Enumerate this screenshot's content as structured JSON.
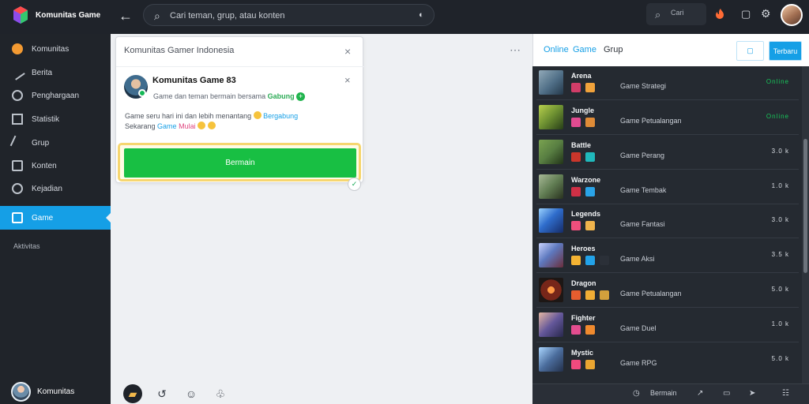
{
  "app": {
    "name": "Komunitas Game",
    "colors": {
      "accent": "#159fe6",
      "success": "#18bf43",
      "dark": "#1f232a"
    }
  },
  "topbar": {
    "back_icon": "arrow-left-icon",
    "search_placeholder": "Cari teman, grup, atau konten",
    "notification_label": "Cari",
    "icons": [
      "search-icon",
      "fire-icon",
      "copy-icon",
      "gear-icon",
      "avatar"
    ]
  },
  "sidebar": {
    "items": [
      {
        "label": "Komunitas",
        "icon": "coin-icon"
      },
      {
        "label": "Berita",
        "icon": "pen-icon"
      },
      {
        "label": "Penghargaan",
        "icon": "globe-icon"
      },
      {
        "label": "Statistik",
        "icon": "chart-icon"
      },
      {
        "label": "Grup",
        "icon": "microphone-icon"
      },
      {
        "label": "Konten",
        "icon": "chat-icon"
      },
      {
        "label": "Kejadian",
        "icon": "clock-icon"
      },
      {
        "label": "Game",
        "icon": "monitor-icon"
      }
    ],
    "section_label": "Aktivitas",
    "profile_name": "Komunitas"
  },
  "post": {
    "header": "Komunitas Gamer Indonesia",
    "title": "Komunitas Game 83",
    "subtitle": "Game dan teman bermain bersama",
    "subtitle_highlight": "Gabung",
    "text_1": "Game seru hari ini dan lebih menantang",
    "text_highlight_1": "Bergabung",
    "text_2": "Sekarang",
    "text_highlight_2": "Game",
    "text_highlight_3": "Mulai",
    "button_label": "Bermain"
  },
  "right_panel": {
    "tabs": [
      "Online",
      "Game",
      "Grup"
    ],
    "button_label": "Terbaru",
    "games": [
      {
        "name": "Arena",
        "meta": "Game Strategi",
        "status": "Online",
        "thumb": "#4f6e86"
      },
      {
        "name": "Jungle",
        "meta": "Game Petualangan",
        "status": "Online",
        "thumb": "#6c8f31"
      },
      {
        "name": "Battle",
        "meta": "Game Perang",
        "status": "3.0 k",
        "thumb": "#587e42"
      },
      {
        "name": "Warzone",
        "meta": "Game Tembak",
        "status": "1.0 k",
        "thumb": "#617d53"
      },
      {
        "name": "Legends",
        "meta": "Game Fantasi",
        "status": "3.0 k",
        "thumb": "#2f6dcc"
      },
      {
        "name": "Heroes",
        "meta": "Game Aksi",
        "status": "3.5 k",
        "thumb": "#5e79bf"
      },
      {
        "name": "Dragon",
        "meta": "Game Petualangan",
        "status": "5.0 k",
        "thumb": "#772619"
      },
      {
        "name": "Fighter",
        "meta": "Game Duel",
        "status": "1.0 k",
        "thumb": "#64579a"
      },
      {
        "name": "Mystic",
        "meta": "Game RPG",
        "status": "5.0 k",
        "thumb": "#4b6d9d"
      }
    ],
    "footer_label": "Bermain"
  }
}
